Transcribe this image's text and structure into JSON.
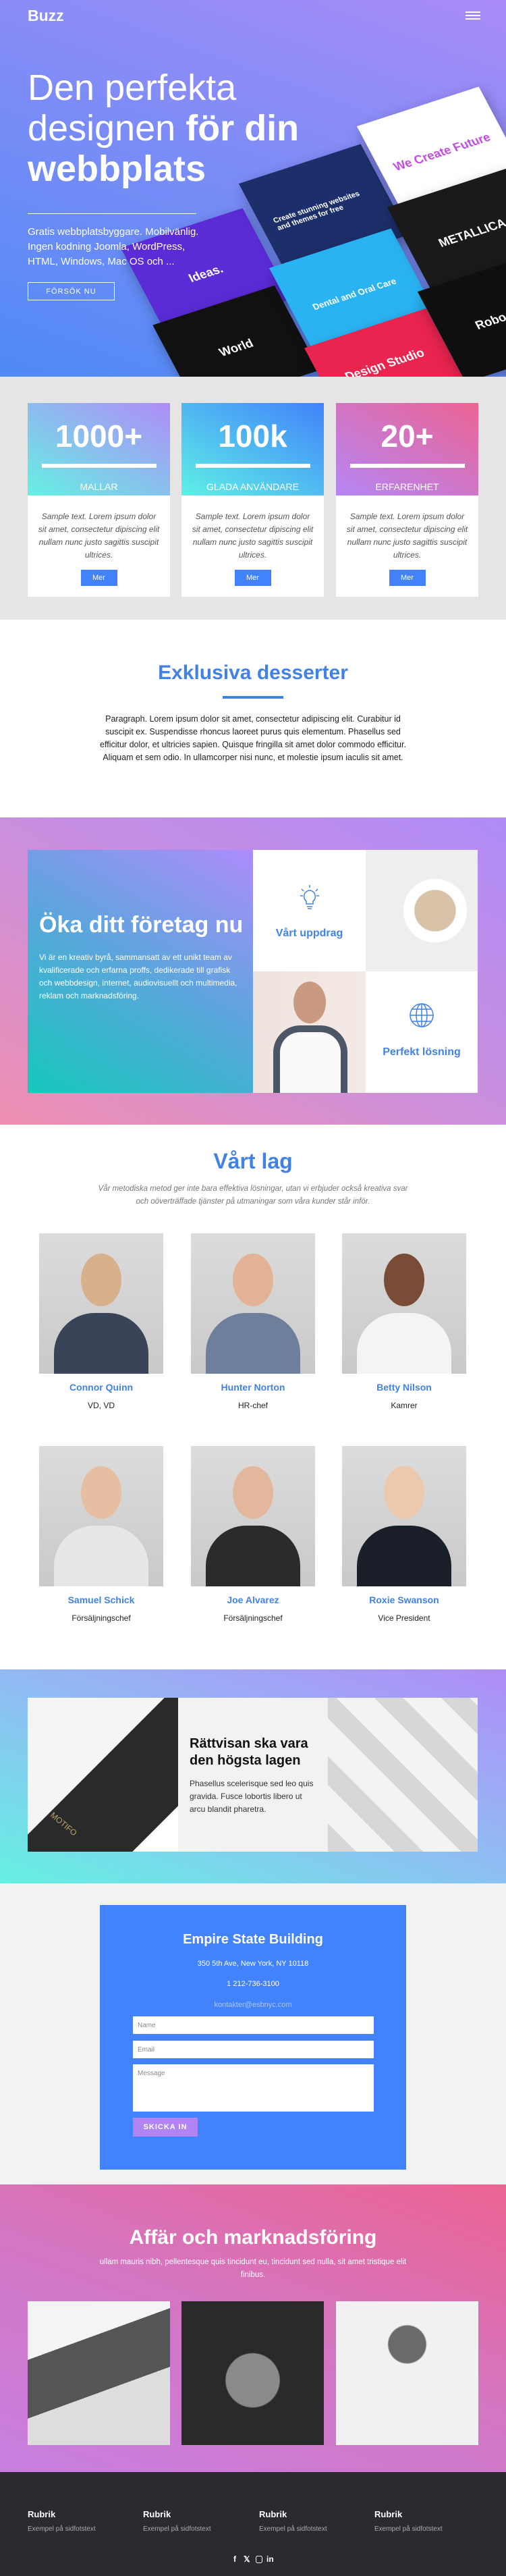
{
  "header": {
    "logo": "Buzz",
    "menu_icon": "hamburger-icon"
  },
  "hero": {
    "title_light": "Den perfekta designen ",
    "title_bold": "för din webbplats",
    "subtitle": "Gratis webbplatsbyggare. Mobilvänlig. Ingen kodning Joomla, WordPress, HTML, Windows, Mac OS och ...",
    "button": "FÖRSÖK NU",
    "mockups": [
      "Ideas.",
      "Create stunning websites and themes for free",
      "We Create Future",
      "World",
      "Dental and Oral Care",
      "METALLICA",
      "Design Studio",
      "Robo The"
    ]
  },
  "stats": [
    {
      "number": "1000+",
      "label": "MALLAR",
      "text": "Sample text. Lorem ipsum dolor sit amet, consectetur dipiscing elit nullam nunc justo sagittis suscipit ultrices.",
      "button": "Mer"
    },
    {
      "number": "100k",
      "label": "GLADA ANVÄNDARE",
      "text": "Sample text. Lorem ipsum dolor sit amet, consectetur dipiscing elit nullam nunc justo sagittis suscipit ultrices.",
      "button": "Mer"
    },
    {
      "number": "20+",
      "label": "ERFARENHET",
      "text": "Sample text. Lorem ipsum dolor sit amet, consectetur dipiscing elit nullam nunc justo sagittis suscipit ultrices.",
      "button": "Mer"
    }
  ],
  "exclusive": {
    "title": "Exklusiva desserter",
    "text": "Paragraph. Lorem ipsum dolor sit amet, consectetur adipiscing elit. Curabitur id suscipit ex. Suspendisse rhoncus laoreet purus quis elementum. Phasellus sed efficitur dolor, et ultricies sapien. Quisque fringilla sit amet dolor commodo efficitur. Aliquam et sem odio. In ullamcorper nisi nunc, et molestie ipsum iaculis sit amet."
  },
  "grow": {
    "title": "Öka ditt företag nu",
    "text": "Vi är en kreativ byrå, sammansatt av ett unikt team av kvalificerade och erfarna proffs, dedikerade till grafisk och webbdesign, internet, audiovisuellt och multimedia, reklam och marknadsföring.",
    "mission": "Vårt uppdrag",
    "solution": "Perfekt lösning"
  },
  "team": {
    "title": "Vårt lag",
    "subtitle": "Vår metodiska metod ger inte bara effektiva lösningar, utan vi erbjuder också kreativa svar och oöverträffade tjänster på utmaningar som våra kunder står inför.",
    "members": [
      {
        "name": "Connor Quinn",
        "role": "VD, VD"
      },
      {
        "name": "Hunter Norton",
        "role": "HR-chef"
      },
      {
        "name": "Betty Nilson",
        "role": "Kamrer"
      },
      {
        "name": "Samuel Schick",
        "role": "Försäljningschef"
      },
      {
        "name": "Joe Alvarez",
        "role": "Försäljningschef"
      },
      {
        "name": "Roxie Swanson",
        "role": "Vice President"
      }
    ]
  },
  "justice": {
    "title": "Rättvisan ska vara den högsta lagen",
    "text": "Phasellus scelerisque sed leo quis gravida. Fusce lobortis libero ut arcu blandit pharetra.",
    "logo_text": "MOTIFO"
  },
  "contact": {
    "title": "Empire State Building",
    "address": "350 5th Ave, New York, NY 10118",
    "phone": "1 212-736-3100",
    "email": "kontakter@esbnyc.com",
    "name_placeholder": "Name",
    "email_placeholder": "Email",
    "message_placeholder": "Message",
    "submit": "SKICKA IN"
  },
  "business": {
    "title": "Affär och marknadsföring",
    "text": "ullam mauris nibh, pellentesque quis tincidunt eu, tincidunt sed nulla, sit amet tristique elit finibus."
  },
  "footer": {
    "columns": [
      {
        "title": "Rubrik",
        "text": "Exempel på sidfotstext"
      },
      {
        "title": "Rubrik",
        "text": "Exempel på sidfotstext"
      },
      {
        "title": "Rubrik",
        "text": "Exempel på sidfotstext"
      },
      {
        "title": "Rubrik",
        "text": "Exempel på sidfotstext"
      }
    ],
    "social": [
      "facebook-icon",
      "twitter-icon",
      "instagram-icon",
      "linkedin-icon"
    ]
  },
  "colors": {
    "accent": "#4282fb",
    "heading_blue": "#4282e6",
    "submit": "#b084f3",
    "footer": "#292b31"
  }
}
